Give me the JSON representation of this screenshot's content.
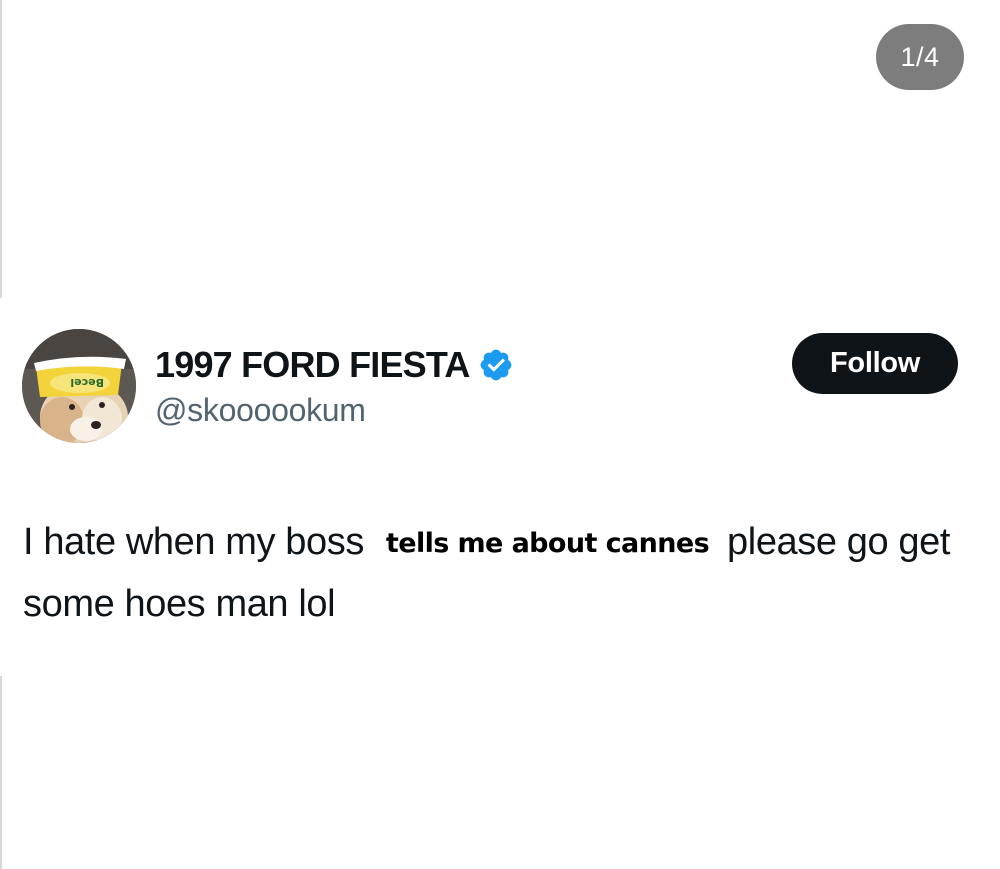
{
  "viewer": {
    "page_counter": "1/4"
  },
  "post": {
    "author": {
      "display_name": "1997 FORD FIESTA",
      "handle": "@skoooookum",
      "verified_icon": "verified-badge-icon",
      "verified_color": "#1d9bf0",
      "avatar_logo_text": "Becel"
    },
    "follow_button_label": "Follow",
    "text": {
      "part1": "I hate when my boss",
      "overlay": "tells me about cannes",
      "part2": "please go get some hoes man lol"
    }
  },
  "colors": {
    "follow_bg": "#0f1419",
    "counter_bg": "#7d7d7d",
    "handle": "#536471"
  }
}
